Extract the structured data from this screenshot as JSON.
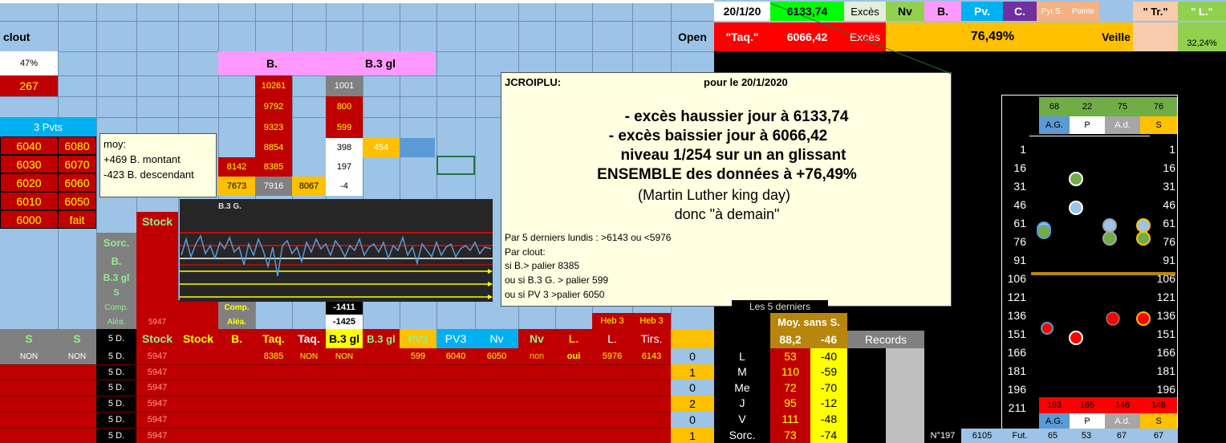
{
  "topbar": {
    "date": "20/1/20",
    "high_value": "6133,74",
    "exces1": "Excès",
    "nv": "Nv",
    "b": "B.",
    "pv": "Pv.",
    "c": "C.",
    "pyrs": "Pyr.S.",
    "pointe": "Pointe",
    "tr": "\" Tr.\"",
    "l": "\" L.\"",
    "open": "Open",
    "taq": "\"Taq.\"",
    "low_value": "6066,42",
    "exces2": "Excès",
    "pct": "76,49%",
    "veille": "Veille",
    "pct_right": "32,24%"
  },
  "left": {
    "clout": "clout",
    "pct47": "47%",
    "n267": "267",
    "pvts": "3 Pvts",
    "pvts_rows": [
      [
        "6040",
        "6080"
      ],
      [
        "6030",
        "6070"
      ],
      [
        "6020",
        "6060"
      ],
      [
        "6010",
        "6050"
      ],
      [
        "6000",
        "fait"
      ]
    ],
    "stock": "Stock",
    "labels": [
      "Sorc.",
      "B.",
      "B.3 gl",
      "S",
      "Comp.",
      "Aléa."
    ],
    "aleat_val": "5947",
    "comp_label": "Comp.",
    "alea_label": "Aléa."
  },
  "comment_moy": {
    "line1": "moy:",
    "line2": "+469 B. montant",
    "line3": "-423 B. descendant"
  },
  "bcol": {
    "header_b": "B.",
    "header_b3": "B.3 gl",
    "b_vals": [
      "10261",
      "9792",
      "9323",
      "8854",
      "8385",
      "7916"
    ],
    "b3_vals": [
      "1001",
      "800",
      "599",
      "398",
      "197",
      "-4"
    ],
    "row8142": "8142",
    "row7673": "7673",
    "row8067": "8067",
    "n454": "454",
    "m1411": "-1411",
    "m1425": "-1425"
  },
  "chart_label": "B.3 G.",
  "note": {
    "author": "JCROIPLU:",
    "for": "pour le  20/1/2020",
    "l1": "- excès haussier jour à 6133,74",
    "l2": "- excès baissier jour à 6066,42",
    "l3": "niveau 1/254 sur un an glissant",
    "l4": "ENSEMBLE des données à +76,49%",
    "l5": "(Martin Luther king day)",
    "l6": "donc \"à demain\"",
    "s1": "Par 5 derniers lundis : >6143 ou <5976",
    "s2": "Par clout:",
    "s3": "si B.> palier 8385",
    "s4": "ou si B.3 G. > palier 599",
    "s5": "ou si PV 3 >palier 6050"
  },
  "table": {
    "heb1": "Heb 3",
    "heb2": "Heb 3",
    "headers": [
      "S",
      "S",
      "5 D.",
      "Stock",
      "Stock",
      "B.",
      "Taq.",
      "Taq.",
      "B.3 gl",
      "B.3 gl",
      "PV3",
      "PV3",
      "Nv",
      "Nv",
      "L.",
      "L.",
      "Tirs."
    ],
    "row1": [
      "NON",
      "NON",
      "5 D.",
      "5947",
      "",
      "",
      "8385",
      "NON",
      "NON",
      "",
      "599",
      "6040",
      "6050",
      "non",
      "oui",
      "5976",
      "6143",
      "0"
    ],
    "rows": [
      [
        "5 D.",
        "5947",
        "1"
      ],
      [
        "5 D.",
        "5947",
        "0"
      ],
      [
        "5 D.",
        "5947",
        "2"
      ],
      [
        "5 D.",
        "5947",
        "0"
      ],
      [
        "5 D.",
        "5947",
        "1"
      ]
    ]
  },
  "stats": {
    "les5": "Les 5 derniers",
    "moy": "Moy. sans S.",
    "m1": "88,2",
    "m2": "-46",
    "records": "Records",
    "days": [
      [
        "L",
        "53",
        "-40"
      ],
      [
        "M",
        "110",
        "-59"
      ],
      [
        "Me",
        "72",
        "-70"
      ],
      [
        "J",
        "95",
        "-12"
      ],
      [
        "V",
        "111",
        "-48"
      ],
      [
        "Sorc.",
        "73",
        "-74"
      ]
    ]
  },
  "bottom": {
    "n197": "N°197",
    "v6105": "6105",
    "fut": "Fut.",
    "v65": "65",
    "v53": "53",
    "v67a": "67",
    "v67b": "67"
  },
  "dots": {
    "top": [
      "68",
      "22",
      "75",
      "76"
    ],
    "top_labels": [
      "A.G.",
      "P",
      "A.d.",
      "S"
    ],
    "scale": [
      "1",
      "16",
      "31",
      "46",
      "61",
      "76",
      "91",
      "106",
      "121",
      "136",
      "151",
      "166",
      "181",
      "196",
      "211"
    ],
    "bot": [
      "153",
      "165",
      "146",
      "146"
    ],
    "bot_labels": [
      "A.G.",
      "P",
      "A.d.",
      "S"
    ]
  },
  "colors": {
    "accent_red": "#c00000",
    "accent_yellow": "#ffff00",
    "bg_blue": "#9dc3e6"
  }
}
